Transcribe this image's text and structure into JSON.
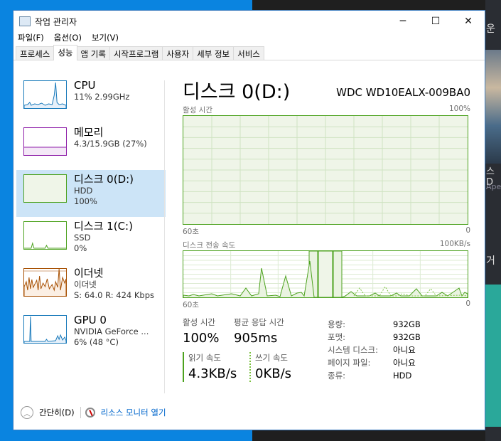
{
  "window": {
    "title": "작업 관리자",
    "minimize": "─",
    "maximize": "☐",
    "close": "✕"
  },
  "menu": [
    "파일(F)",
    "옵션(O)",
    "보기(V)"
  ],
  "tabs": [
    "프로세스",
    "성능",
    "앱 기록",
    "시작프로그램",
    "사용자",
    "세부 정보",
    "서비스"
  ],
  "active_tab": "성능",
  "sidebar": [
    {
      "name": "CPU",
      "sub1": "11% 2.99GHz",
      "sub2": "",
      "color": "#1779ba"
    },
    {
      "name": "메모리",
      "sub1": "4.3/15.9GB (27%)",
      "sub2": "",
      "color": "#8e1ea8"
    },
    {
      "name": "디스크 0(D:)",
      "sub1": "HDD",
      "sub2": "100%",
      "color": "#4ca21e",
      "selected": true
    },
    {
      "name": "디스크 1(C:)",
      "sub1": "SSD",
      "sub2": "0%",
      "color": "#4ca21e"
    },
    {
      "name": "이더넷",
      "sub1": "이더넷",
      "sub2": "S: 64.0 R: 424 Kbps",
      "color": "#a74f01"
    },
    {
      "name": "GPU 0",
      "sub1": "NVIDIA GeForce ...",
      "sub2": "6% (48 °C)",
      "color": "#1779ba"
    }
  ],
  "main": {
    "title": "디스크 0(D:)",
    "model": "WDC WD10EALX-009BA0",
    "graph1": {
      "label": "활성 시간",
      "max": "100%",
      "left": "60초",
      "right": "0",
      "value_percent": 100
    },
    "graph2": {
      "label": "디스크 전송 속도",
      "max": "100KB/s",
      "left": "60초",
      "right": "0"
    },
    "stats": {
      "active_label": "활성 시간",
      "active_value": "100%",
      "resp_label": "평균 응답 시간",
      "resp_value": "905ms",
      "read_label": "읽기 속도",
      "read_value": "4.3KB/s",
      "write_label": "쓰기 속도",
      "write_value": "0KB/s"
    },
    "props": [
      {
        "k": "용량:",
        "v": "932GB"
      },
      {
        "k": "포맷:",
        "v": "932GB"
      },
      {
        "k": "시스템 디스크:",
        "v": "아니요"
      },
      {
        "k": "페이지 파일:",
        "v": "아니요"
      },
      {
        "k": "종류:",
        "v": "HDD"
      }
    ]
  },
  "footer": {
    "fewer": "간단히(D)",
    "resmon": "리소스 모니터 열기"
  },
  "background": {
    "t1": "운",
    "t2": "스D",
    "t3": "Apex",
    "t4": "거"
  }
}
